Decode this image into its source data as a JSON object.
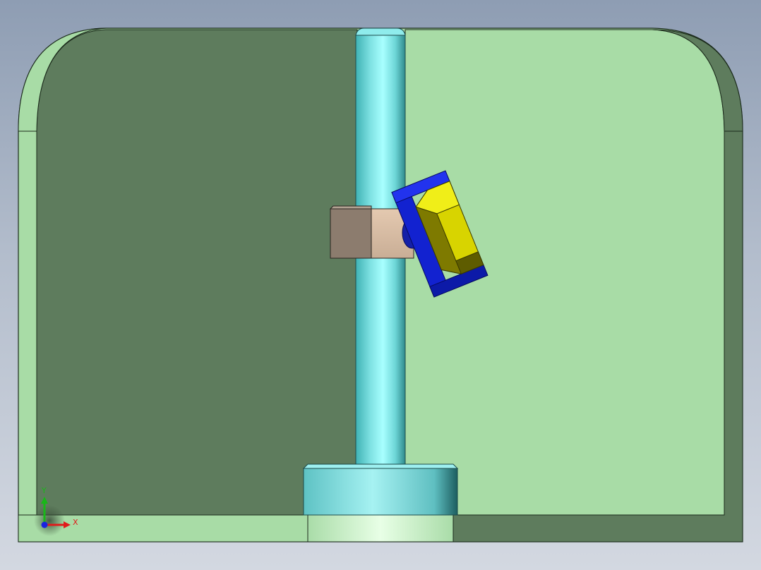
{
  "viewport": {
    "background_top": "#8e9db3",
    "background_bottom": "#d3d8e1"
  },
  "triad": {
    "x_label": "X",
    "y_label": "Y",
    "x_color": "#e01b1b",
    "y_color": "#18b818",
    "z_color": "#1a22e0"
  },
  "colors": {
    "frame_light": "#a8dca6",
    "frame_dark": "#5e7c5d",
    "post": "#7fe6e6",
    "collar": "#d5b9a0",
    "block": "#8c7c6e",
    "clamp_blue": "#1222d0",
    "clamp_yellow": "#d8d400"
  },
  "model": {
    "parts": [
      "frame",
      "post",
      "base-cylinder",
      "collar-block",
      "clamp-head"
    ]
  }
}
